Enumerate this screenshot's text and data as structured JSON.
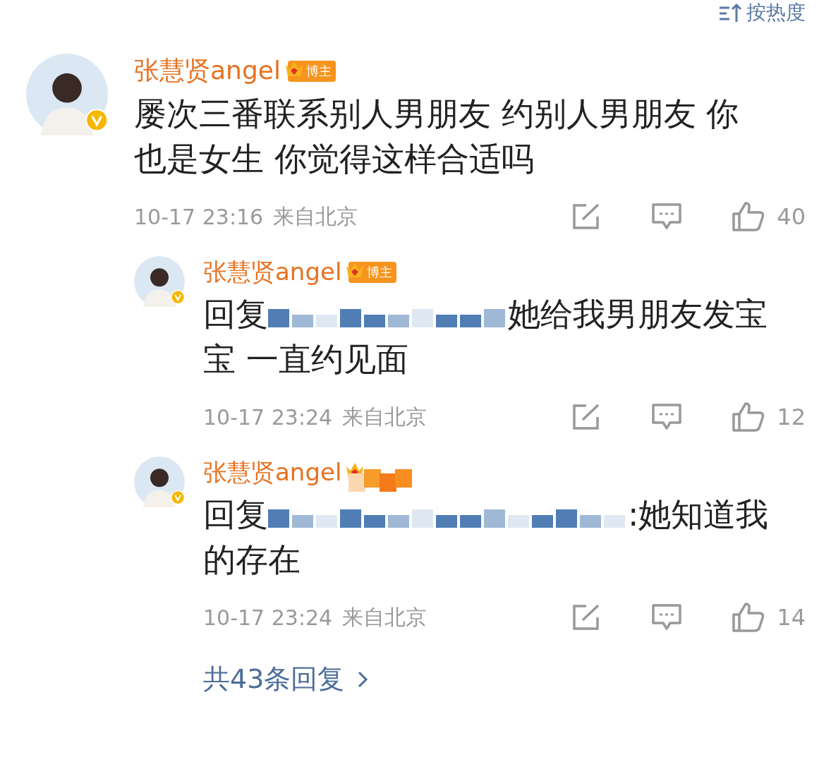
{
  "sort": {
    "label": "按热度"
  },
  "comment": {
    "user": "张慧贤angel",
    "verified": true,
    "badge": {
      "kind": "plain",
      "label": "博主"
    },
    "text": "屡次三番联系别人男朋友 约别人男朋友 你也是女生 你觉得这样合适吗",
    "time": "10-17 23:16",
    "location": "来自北京",
    "likes": "40"
  },
  "replies": [
    {
      "user": "张慧贤angel",
      "verified": true,
      "badge": {
        "kind": "plain",
        "label": "博主"
      },
      "prefix": "回复",
      "text": "她给我男朋友发宝宝 一直约见面",
      "time": "10-17 23:24",
      "location": "来自北京",
      "likes": "12"
    },
    {
      "user": "张慧贤angel",
      "verified": true,
      "badge": {
        "kind": "obscured"
      },
      "prefix": "回复",
      "text": ":她知道我的存在",
      "time": "10-17 23:24",
      "location": "来自北京",
      "likes": "14"
    }
  ],
  "more_replies": "共43条回复"
}
